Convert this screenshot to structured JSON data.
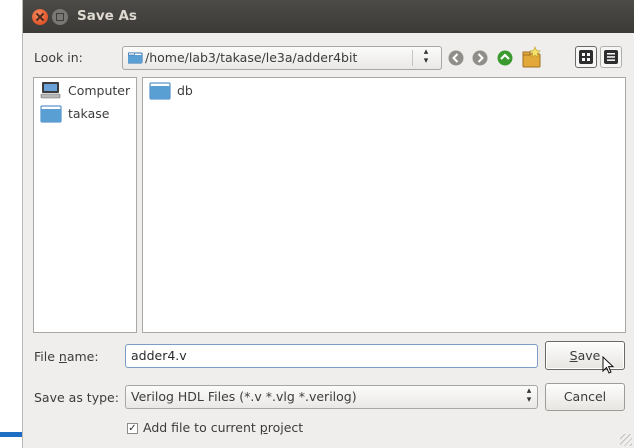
{
  "window": {
    "title": "Save As"
  },
  "look_in": {
    "label": "Look in:",
    "path": "/home/lab3/takase/le3a/adder4bit"
  },
  "toolbar": {
    "back": "back-icon",
    "forward": "forward-icon",
    "up": "up-icon",
    "new_folder": "new-folder-icon",
    "icon_view": "icon-view-icon",
    "detail_view": "detail-view-icon"
  },
  "sidebar": {
    "items": [
      {
        "label": "Computer",
        "icon": "computer-icon"
      },
      {
        "label": "takase",
        "icon": "folder-icon"
      }
    ]
  },
  "files": {
    "items": [
      {
        "name": "db",
        "icon": "folder-icon"
      }
    ]
  },
  "file_name": {
    "label_pre": "File ",
    "label_u": "n",
    "label_post": "ame:",
    "value": "adder4.v"
  },
  "save_type": {
    "label": "Save as type:",
    "value": "Verilog HDL Files (*.v *.vlg *.verilog)"
  },
  "buttons": {
    "save_u": "S",
    "save_rest": "ave",
    "cancel": "Cancel"
  },
  "add_to_project": {
    "checked": true,
    "label_pre": "Add file to current ",
    "label_u": "p",
    "label_post": "roject"
  },
  "colors": {
    "titlebar": "#3c3b37",
    "close": "#e7643a",
    "folder_blue": "#5a9fd4",
    "up_green": "#3a9a2e",
    "accent_blue": "#1e6fc4"
  }
}
